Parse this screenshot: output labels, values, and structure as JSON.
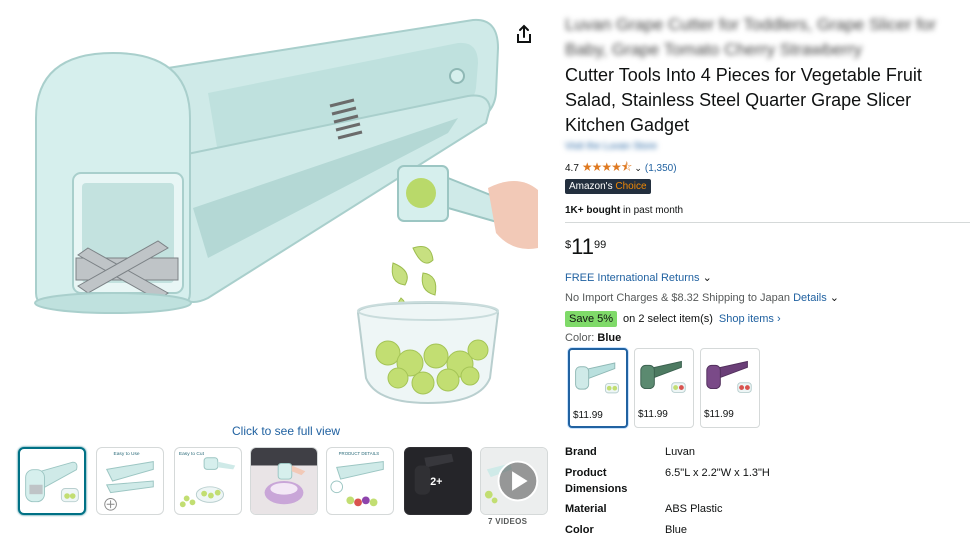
{
  "product": {
    "title_blurred": "Luvan Grape Cutter for Toddlers, Grape Slicer for Baby, Grape Tomato Cherry Strawberry",
    "title_visible": "Cutter Tools Into 4 Pieces for Vegetable Fruit Salad, Stainless Steel Quarter Grape Slicer Kitchen Gadget",
    "store_link": "Visit the Luvan Store",
    "rating": "4.7",
    "stars": "★★★★⯪",
    "ratings_count": "(1,350)",
    "badge_main": "Amazon's",
    "badge_choice": "Choice",
    "bought_bold": "1K+ bought",
    "bought_rest": " in past month"
  },
  "price": {
    "symbol": "$",
    "whole": "11",
    "fraction": "99"
  },
  "shipping": {
    "returns": "FREE International Returns",
    "import_text": "No Import Charges & $8.32 Shipping to Japan",
    "details": "Details"
  },
  "coupon": {
    "badge": "Save 5%",
    "text": "on 2 select item(s)",
    "link": "Shop items ›"
  },
  "color": {
    "label": "Color: ",
    "selected": "Blue",
    "swatches": [
      {
        "name": "Blue",
        "price": "$11.99",
        "color": "#b9e0de"
      },
      {
        "name": "Green",
        "price": "$11.99",
        "color": "#4d7a61"
      },
      {
        "name": "Purple",
        "price": "$11.99",
        "color": "#6b3f78"
      }
    ]
  },
  "gallery": {
    "full_view_link": "Click to see full view",
    "more_count": "2+",
    "videos_label": "7 VIDEOS",
    "thumb_texts": {
      "easy": "Easy to Use",
      "cut": "Easy to Cut",
      "details": "PRODUCT DETAILS"
    }
  },
  "specs": [
    {
      "label": "Brand",
      "value": "Luvan"
    },
    {
      "label": "Product Dimensions",
      "value": "6.5\"L x 2.2\"W x 1.3\"H"
    },
    {
      "label": "Material",
      "value": "ABS Plastic"
    },
    {
      "label": "Color",
      "value": "Blue"
    }
  ],
  "colors": {
    "accent_link": "#2162a1",
    "product_body": "#cfeae8",
    "save_green": "#7fda69",
    "star": "#de7921"
  }
}
